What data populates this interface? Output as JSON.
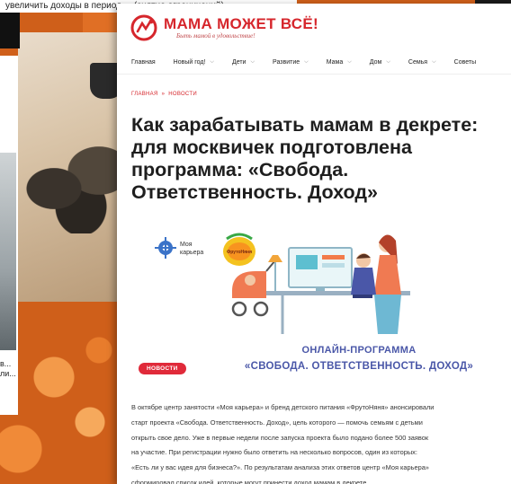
{
  "background": {
    "top_strip_text": "увеличить доходы в период ... (снятие ограничений) ...  ...",
    "left_snippet": "в... ли..."
  },
  "site": {
    "title": "МАМА МОЖЕТ ВСЁ!",
    "tagline": "Быть мамой в удовольствие!",
    "brand_color": "#d6262c"
  },
  "nav": {
    "items": [
      {
        "label": "Главная",
        "has_caret": false
      },
      {
        "label": "Новый год!",
        "has_caret": true
      },
      {
        "label": "Дети",
        "has_caret": true
      },
      {
        "label": "Развитие",
        "has_caret": true
      },
      {
        "label": "Мама",
        "has_caret": true
      },
      {
        "label": "Дом",
        "has_caret": true
      },
      {
        "label": "Семья",
        "has_caret": true
      },
      {
        "label": "Советы",
        "has_caret": false
      }
    ]
  },
  "breadcrumbs": {
    "home": "ГЛАВНАЯ",
    "separator": "»",
    "section": "НОВОСТИ"
  },
  "article": {
    "headline": "Как зарабатывать мамам в декрете: для москвичек подготовлена программа: «Свобода. Ответственность. Доход»",
    "image": {
      "partner_logo_line1": "Моя",
      "partner_logo_line2": "карьера",
      "brand_logo": "ФрутоНяня",
      "promo_line1": "ОНЛАЙН-ПРОГРАММА",
      "promo_line2": "«СВОБОДА. ОТВЕТСТВЕННОСТЬ. ДОХОД»",
      "accent_color": "#4a57a8"
    },
    "badge": "НОВОСТИ",
    "paragraph_lines": [
      "В октябре центр занятости «Моя карьера» и бренд детского питания «ФрутоНяня» анонсировали",
      "старт проекта «Свобода. Ответственность. Доход», цель которого — помочь семьям с детьми",
      "открыть свое дело. Уже в первые недели после запуска проекта было подано более 500 заявок",
      "на участие. При регистрации нужно было ответить на несколько вопросов, один из которых:",
      "«Есть ли у вас идея для бизнеса?». По результатам анализа этих ответов центр «Моя карьера»",
      "сформировал список идей, которые могут принести доход мамам в декрете."
    ]
  }
}
